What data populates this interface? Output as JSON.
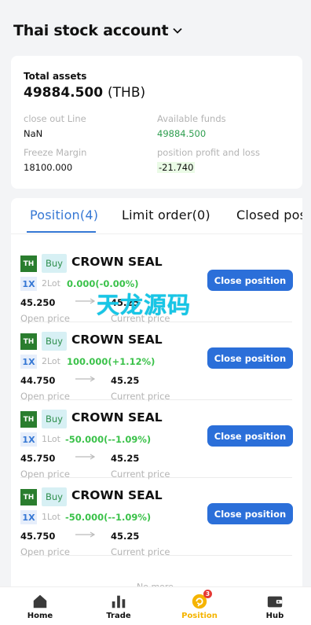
{
  "header": {
    "title": "Thai stock account",
    "chevron_icon": "chevron-down-icon"
  },
  "summary": {
    "total_label": "Total assets",
    "total_value": "49884.500",
    "total_unit": "(THB)",
    "closeout_label": "close out Line",
    "closeout_value": "NaN",
    "funds_label": "Available funds",
    "funds_value": "49884.500",
    "freeze_label": "Freeze Margin",
    "freeze_value": "18100.000",
    "pl_label": "position profit and loss",
    "pl_value": "-21.740"
  },
  "tabs": [
    {
      "label": "Position(4)",
      "active": true
    },
    {
      "label": "Limit order(0)",
      "active": false
    },
    {
      "label": "Closed position",
      "active": false
    }
  ],
  "orders": [
    {
      "market": "TH",
      "side": "Buy",
      "name": "CROWN SEAL",
      "leverage": "1X",
      "lots": "2Lot",
      "pnl": "0.000(-0.00%)",
      "close_label": "Close position",
      "open_price": "45.250",
      "current_price": "45.25",
      "open_label": "Open price",
      "current_label": "Current price"
    },
    {
      "market": "TH",
      "side": "Buy",
      "name": "CROWN SEAL",
      "leverage": "1X",
      "lots": "2Lot",
      "pnl": "100.000(+1.12%)",
      "close_label": "Close position",
      "open_price": "44.750",
      "current_price": "45.25",
      "open_label": "Open price",
      "current_label": "Current price"
    },
    {
      "market": "TH",
      "side": "Buy",
      "name": "CROWN SEAL",
      "leverage": "1X",
      "lots": "1Lot",
      "pnl": "-50.000(--1.09%)",
      "close_label": "Close position",
      "open_price": "45.750",
      "current_price": "45.25",
      "open_label": "Open price",
      "current_label": "Current price"
    },
    {
      "market": "TH",
      "side": "Buy",
      "name": "CROWN SEAL",
      "leverage": "1X",
      "lots": "1Lot",
      "pnl": "-50.000(--1.09%)",
      "close_label": "Close position",
      "open_price": "45.750",
      "current_price": "45.25",
      "open_label": "Open price",
      "current_label": "Current price"
    }
  ],
  "list_end": "No more",
  "watermark": "天龙源码",
  "nav": {
    "items": [
      {
        "label": "Home",
        "icon": "home-icon"
      },
      {
        "label": "Trade",
        "icon": "chart-bars-icon"
      },
      {
        "label": "Position",
        "icon": "position-icon",
        "active": true,
        "badge": "3"
      },
      {
        "label": "Hub",
        "icon": "wallet-icon"
      }
    ],
    "active_color": "#f5b400"
  }
}
